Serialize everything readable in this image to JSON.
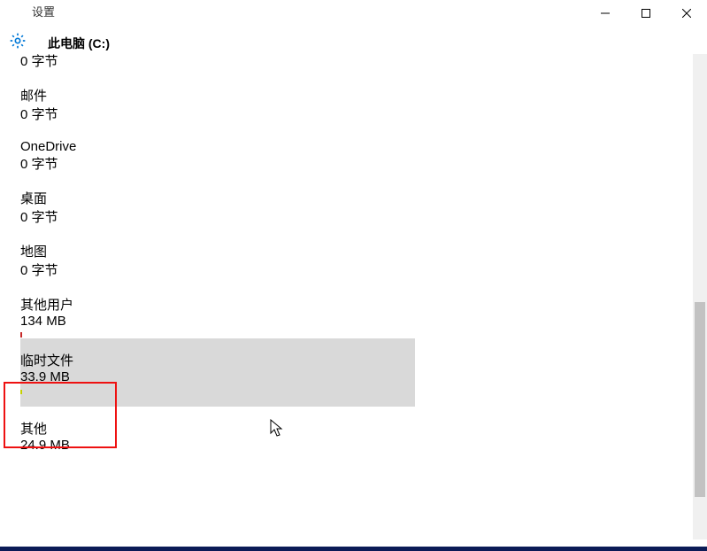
{
  "window": {
    "title": "设置",
    "page_title": "此电脑 (C:)"
  },
  "items": [
    {
      "name": "",
      "size": "0 字节",
      "firstCut": true
    },
    {
      "name": "邮件",
      "size": "0 字节"
    },
    {
      "name": "OneDrive",
      "size": "0 字节"
    },
    {
      "name": "桌面",
      "size": "0 字节"
    },
    {
      "name": "地图",
      "size": "0 字节"
    },
    {
      "name": "其他用户",
      "size": "134 MB",
      "barClass": "other-users"
    },
    {
      "name": "临时文件",
      "size": "33.9 MB",
      "selected": true
    },
    {
      "name": "其他",
      "size": "24.9 MB"
    }
  ]
}
